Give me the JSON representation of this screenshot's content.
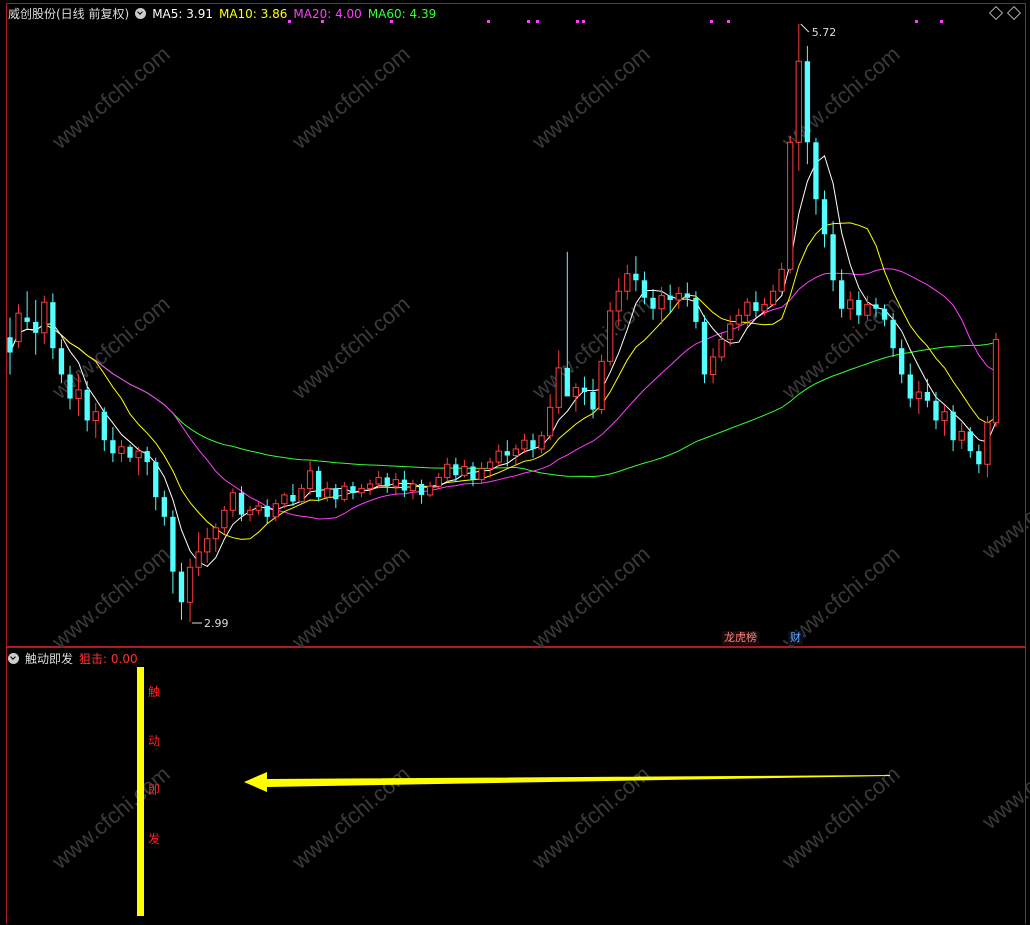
{
  "main_panel": {
    "stock_name": "威创股份(日线 前复权)",
    "ma_labels": [
      {
        "text": "MA5: 3.91",
        "color": "#ffffff"
      },
      {
        "text": "MA10: 3.86",
        "color": "#ffff00"
      },
      {
        "text": "MA20: 4.00",
        "color": "#ff3dff"
      },
      {
        "text": "MA60: 4.39",
        "color": "#33ff33"
      }
    ],
    "high_label": "5.72",
    "low_label": "2.99",
    "event_tags": [
      {
        "text": "龙虎榜",
        "color": "#ff8080"
      },
      {
        "text": "财",
        "color": "#66aaff"
      }
    ]
  },
  "sub_panel": {
    "indicator_name": "触动即发",
    "signal_label": "狙击: 0.00",
    "vertical_text": [
      "触",
      "动",
      "即",
      "发"
    ],
    "colors": {
      "bar": "#ffff00",
      "text": "#ff2020",
      "arrow": "#ffff00"
    }
  },
  "watermark": "www.cfchi.com",
  "colors": {
    "up": "#ff3c3c",
    "down": "#54ffff",
    "frame": "#b0191e",
    "ma5": "#ffffff",
    "ma10": "#ffff00",
    "ma20": "#ff3dff",
    "ma60": "#33ff33"
  },
  "chart_data": {
    "type": "candlestick",
    "price_range": [
      2.99,
      5.72
    ],
    "candles": [
      {
        "o": 4.29,
        "h": 4.38,
        "l": 4.12,
        "c": 4.22
      },
      {
        "o": 4.27,
        "h": 4.44,
        "l": 4.24,
        "c": 4.4
      },
      {
        "o": 4.38,
        "h": 4.5,
        "l": 4.33,
        "c": 4.36
      },
      {
        "o": 4.36,
        "h": 4.46,
        "l": 4.21,
        "c": 4.31
      },
      {
        "o": 4.31,
        "h": 4.48,
        "l": 4.26,
        "c": 4.45
      },
      {
        "o": 4.45,
        "h": 4.49,
        "l": 4.19,
        "c": 4.24
      },
      {
        "o": 4.24,
        "h": 4.28,
        "l": 4.08,
        "c": 4.12
      },
      {
        "o": 4.12,
        "h": 4.16,
        "l": 3.96,
        "c": 4.01
      },
      {
        "o": 4.01,
        "h": 4.12,
        "l": 3.93,
        "c": 4.05
      },
      {
        "o": 4.05,
        "h": 4.09,
        "l": 3.86,
        "c": 3.91
      },
      {
        "o": 3.91,
        "h": 3.99,
        "l": 3.83,
        "c": 3.95
      },
      {
        "o": 3.95,
        "h": 3.97,
        "l": 3.77,
        "c": 3.82
      },
      {
        "o": 3.82,
        "h": 3.88,
        "l": 3.72,
        "c": 3.76
      },
      {
        "o": 3.76,
        "h": 3.82,
        "l": 3.72,
        "c": 3.79
      },
      {
        "o": 3.79,
        "h": 3.8,
        "l": 3.72,
        "c": 3.74
      },
      {
        "o": 3.74,
        "h": 3.79,
        "l": 3.66,
        "c": 3.77
      },
      {
        "o": 3.77,
        "h": 3.79,
        "l": 3.66,
        "c": 3.72
      },
      {
        "o": 3.72,
        "h": 3.74,
        "l": 3.5,
        "c": 3.56
      },
      {
        "o": 3.56,
        "h": 3.59,
        "l": 3.43,
        "c": 3.47
      },
      {
        "o": 3.47,
        "h": 3.5,
        "l": 3.12,
        "c": 3.22
      },
      {
        "o": 3.22,
        "h": 3.26,
        "l": 3.0,
        "c": 3.08
      },
      {
        "o": 3.08,
        "h": 3.28,
        "l": 2.99,
        "c": 3.24
      },
      {
        "o": 3.24,
        "h": 3.4,
        "l": 3.2,
        "c": 3.31
      },
      {
        "o": 3.31,
        "h": 3.42,
        "l": 3.26,
        "c": 3.37
      },
      {
        "o": 3.37,
        "h": 3.44,
        "l": 3.31,
        "c": 3.42
      },
      {
        "o": 3.42,
        "h": 3.52,
        "l": 3.39,
        "c": 3.5
      },
      {
        "o": 3.5,
        "h": 3.6,
        "l": 3.47,
        "c": 3.58
      },
      {
        "o": 3.58,
        "h": 3.61,
        "l": 3.45,
        "c": 3.48
      },
      {
        "o": 3.48,
        "h": 3.52,
        "l": 3.45,
        "c": 3.5
      },
      {
        "o": 3.5,
        "h": 3.54,
        "l": 3.48,
        "c": 3.52
      },
      {
        "o": 3.52,
        "h": 3.55,
        "l": 3.44,
        "c": 3.47
      },
      {
        "o": 3.47,
        "h": 3.55,
        "l": 3.45,
        "c": 3.53
      },
      {
        "o": 3.53,
        "h": 3.58,
        "l": 3.51,
        "c": 3.57
      },
      {
        "o": 3.57,
        "h": 3.62,
        "l": 3.52,
        "c": 3.54
      },
      {
        "o": 3.54,
        "h": 3.62,
        "l": 3.53,
        "c": 3.6
      },
      {
        "o": 3.6,
        "h": 3.73,
        "l": 3.57,
        "c": 3.68
      },
      {
        "o": 3.68,
        "h": 3.7,
        "l": 3.54,
        "c": 3.56
      },
      {
        "o": 3.56,
        "h": 3.63,
        "l": 3.54,
        "c": 3.6
      },
      {
        "o": 3.6,
        "h": 3.62,
        "l": 3.51,
        "c": 3.55
      },
      {
        "o": 3.55,
        "h": 3.63,
        "l": 3.54,
        "c": 3.61
      },
      {
        "o": 3.61,
        "h": 3.63,
        "l": 3.55,
        "c": 3.58
      },
      {
        "o": 3.58,
        "h": 3.62,
        "l": 3.56,
        "c": 3.6
      },
      {
        "o": 3.6,
        "h": 3.64,
        "l": 3.57,
        "c": 3.62
      },
      {
        "o": 3.62,
        "h": 3.68,
        "l": 3.6,
        "c": 3.65
      },
      {
        "o": 3.65,
        "h": 3.67,
        "l": 3.58,
        "c": 3.61
      },
      {
        "o": 3.61,
        "h": 3.67,
        "l": 3.57,
        "c": 3.64
      },
      {
        "o": 3.64,
        "h": 3.68,
        "l": 3.56,
        "c": 3.59
      },
      {
        "o": 3.59,
        "h": 3.64,
        "l": 3.55,
        "c": 3.62
      },
      {
        "o": 3.62,
        "h": 3.64,
        "l": 3.53,
        "c": 3.57
      },
      {
        "o": 3.57,
        "h": 3.63,
        "l": 3.56,
        "c": 3.61
      },
      {
        "o": 3.61,
        "h": 3.67,
        "l": 3.6,
        "c": 3.65
      },
      {
        "o": 3.65,
        "h": 3.74,
        "l": 3.63,
        "c": 3.71
      },
      {
        "o": 3.71,
        "h": 3.74,
        "l": 3.63,
        "c": 3.66
      },
      {
        "o": 3.66,
        "h": 3.73,
        "l": 3.65,
        "c": 3.7
      },
      {
        "o": 3.7,
        "h": 3.72,
        "l": 3.61,
        "c": 3.64
      },
      {
        "o": 3.64,
        "h": 3.72,
        "l": 3.62,
        "c": 3.69
      },
      {
        "o": 3.69,
        "h": 3.74,
        "l": 3.65,
        "c": 3.72
      },
      {
        "o": 3.72,
        "h": 3.8,
        "l": 3.7,
        "c": 3.77
      },
      {
        "o": 3.77,
        "h": 3.82,
        "l": 3.7,
        "c": 3.75
      },
      {
        "o": 3.75,
        "h": 3.8,
        "l": 3.71,
        "c": 3.78
      },
      {
        "o": 3.78,
        "h": 3.85,
        "l": 3.76,
        "c": 3.82
      },
      {
        "o": 3.82,
        "h": 3.85,
        "l": 3.74,
        "c": 3.78
      },
      {
        "o": 3.78,
        "h": 3.86,
        "l": 3.76,
        "c": 3.84
      },
      {
        "o": 3.84,
        "h": 4.03,
        "l": 3.82,
        "c": 3.97
      },
      {
        "o": 3.97,
        "h": 4.23,
        "l": 3.94,
        "c": 4.15
      },
      {
        "o": 4.15,
        "h": 4.68,
        "l": 4.11,
        "c": 4.02
      },
      {
        "o": 4.02,
        "h": 4.08,
        "l": 3.95,
        "c": 4.06
      },
      {
        "o": 4.06,
        "h": 4.11,
        "l": 3.98,
        "c": 4.04
      },
      {
        "o": 4.04,
        "h": 4.1,
        "l": 3.92,
        "c": 3.96
      },
      {
        "o": 3.96,
        "h": 4.21,
        "l": 3.94,
        "c": 4.18
      },
      {
        "o": 4.18,
        "h": 4.45,
        "l": 4.16,
        "c": 4.41
      },
      {
        "o": 4.41,
        "h": 4.56,
        "l": 4.34,
        "c": 4.5
      },
      {
        "o": 4.5,
        "h": 4.62,
        "l": 4.46,
        "c": 4.58
      },
      {
        "o": 4.58,
        "h": 4.66,
        "l": 4.5,
        "c": 4.55
      },
      {
        "o": 4.55,
        "h": 4.59,
        "l": 4.44,
        "c": 4.47
      },
      {
        "o": 4.47,
        "h": 4.51,
        "l": 4.37,
        "c": 4.42
      },
      {
        "o": 4.42,
        "h": 4.52,
        "l": 4.35,
        "c": 4.48
      },
      {
        "o": 4.48,
        "h": 4.53,
        "l": 4.4,
        "c": 4.46
      },
      {
        "o": 4.46,
        "h": 4.52,
        "l": 4.42,
        "c": 4.49
      },
      {
        "o": 4.49,
        "h": 4.54,
        "l": 4.43,
        "c": 4.47
      },
      {
        "o": 4.47,
        "h": 4.5,
        "l": 4.33,
        "c": 4.36
      },
      {
        "o": 4.36,
        "h": 4.39,
        "l": 4.08,
        "c": 4.12
      },
      {
        "o": 4.12,
        "h": 4.24,
        "l": 4.08,
        "c": 4.2
      },
      {
        "o": 4.2,
        "h": 4.31,
        "l": 4.18,
        "c": 4.28
      },
      {
        "o": 4.28,
        "h": 4.39,
        "l": 4.25,
        "c": 4.35
      },
      {
        "o": 4.35,
        "h": 4.42,
        "l": 4.32,
        "c": 4.39
      },
      {
        "o": 4.39,
        "h": 4.47,
        "l": 4.34,
        "c": 4.45
      },
      {
        "o": 4.45,
        "h": 4.5,
        "l": 4.38,
        "c": 4.41
      },
      {
        "o": 4.41,
        "h": 4.47,
        "l": 4.39,
        "c": 4.44
      },
      {
        "o": 4.44,
        "h": 4.53,
        "l": 4.43,
        "c": 4.5
      },
      {
        "o": 4.5,
        "h": 4.63,
        "l": 4.49,
        "c": 4.6
      },
      {
        "o": 4.6,
        "h": 5.21,
        "l": 4.58,
        "c": 5.18
      },
      {
        "o": 5.18,
        "h": 5.72,
        "l": 5.05,
        "c": 5.55
      },
      {
        "o": 5.55,
        "h": 5.62,
        "l": 5.08,
        "c": 5.18
      },
      {
        "o": 5.18,
        "h": 5.2,
        "l": 4.85,
        "c": 4.92
      },
      {
        "o": 4.92,
        "h": 4.96,
        "l": 4.7,
        "c": 4.76
      },
      {
        "o": 4.76,
        "h": 4.82,
        "l": 4.5,
        "c": 4.55
      },
      {
        "o": 4.55,
        "h": 4.6,
        "l": 4.38,
        "c": 4.42
      },
      {
        "o": 4.42,
        "h": 4.5,
        "l": 4.37,
        "c": 4.46
      },
      {
        "o": 4.46,
        "h": 4.5,
        "l": 4.35,
        "c": 4.39
      },
      {
        "o": 4.39,
        "h": 4.48,
        "l": 4.37,
        "c": 4.44
      },
      {
        "o": 4.44,
        "h": 4.47,
        "l": 4.38,
        "c": 4.42
      },
      {
        "o": 4.42,
        "h": 4.44,
        "l": 4.34,
        "c": 4.37
      },
      {
        "o": 4.37,
        "h": 4.4,
        "l": 4.2,
        "c": 4.24
      },
      {
        "o": 4.24,
        "h": 4.28,
        "l": 4.08,
        "c": 4.12
      },
      {
        "o": 4.12,
        "h": 4.17,
        "l": 3.97,
        "c": 4.01
      },
      {
        "o": 4.01,
        "h": 4.09,
        "l": 3.94,
        "c": 4.04
      },
      {
        "o": 4.04,
        "h": 4.1,
        "l": 3.97,
        "c": 4.0
      },
      {
        "o": 4.0,
        "h": 4.04,
        "l": 3.87,
        "c": 3.91
      },
      {
        "o": 3.91,
        "h": 3.98,
        "l": 3.84,
        "c": 3.95
      },
      {
        "o": 3.95,
        "h": 3.98,
        "l": 3.77,
        "c": 3.82
      },
      {
        "o": 3.82,
        "h": 3.9,
        "l": 3.78,
        "c": 3.86
      },
      {
        "o": 3.86,
        "h": 3.88,
        "l": 3.74,
        "c": 3.77
      },
      {
        "o": 3.77,
        "h": 3.8,
        "l": 3.67,
        "c": 3.71
      },
      {
        "o": 3.71,
        "h": 3.93,
        "l": 3.65,
        "c": 3.9
      },
      {
        "o": 3.9,
        "h": 4.31,
        "l": 3.88,
        "c": 4.28
      }
    ]
  }
}
